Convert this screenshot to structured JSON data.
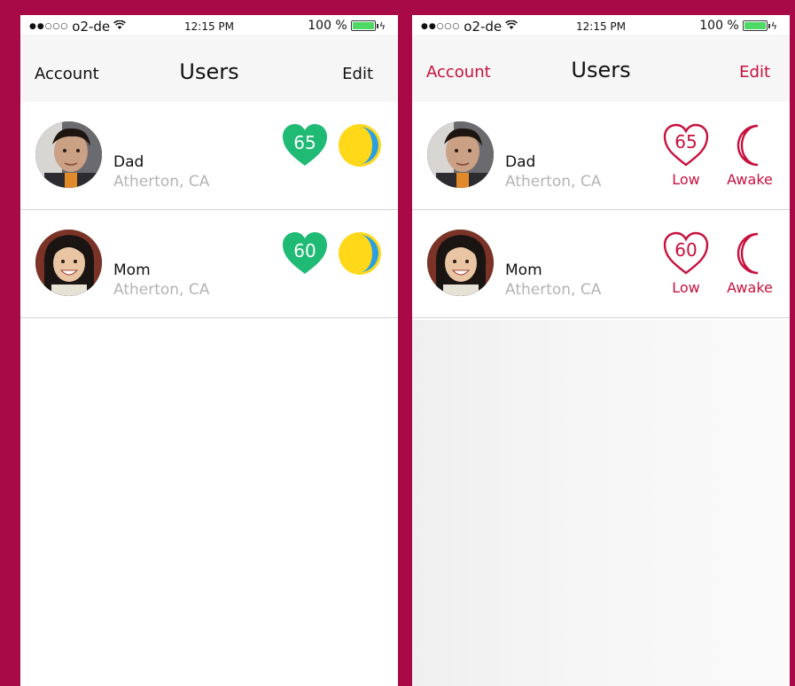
{
  "status_bar": {
    "signal_dots": "●●○○○",
    "carrier": "o2-de",
    "time": "12:15 PM",
    "battery": "100 %",
    "battery_level": 1.0
  },
  "nav": {
    "left_label": "Account",
    "title": "Users",
    "right_label": "Edit"
  },
  "colors": {
    "frame": "#a80a48",
    "heart_filled": "#1fba74",
    "moon_fill": "#ffd81a",
    "moon_shadow": "#2a9fe2",
    "accent_red": "#c8103d"
  },
  "icons": {
    "heart": "heart-icon",
    "moon": "moon-icon",
    "wifi": "wifi-icon",
    "battery": "battery-icon"
  },
  "users": [
    {
      "name": "Dad",
      "location": "Atherton, CA",
      "heart_rate": "65",
      "heart_status": "Low",
      "sleep_status": "Awake"
    },
    {
      "name": "Mom",
      "location": "Atherton, CA",
      "heart_rate": "60",
      "heart_status": "Low",
      "sleep_status": "Awake"
    }
  ]
}
